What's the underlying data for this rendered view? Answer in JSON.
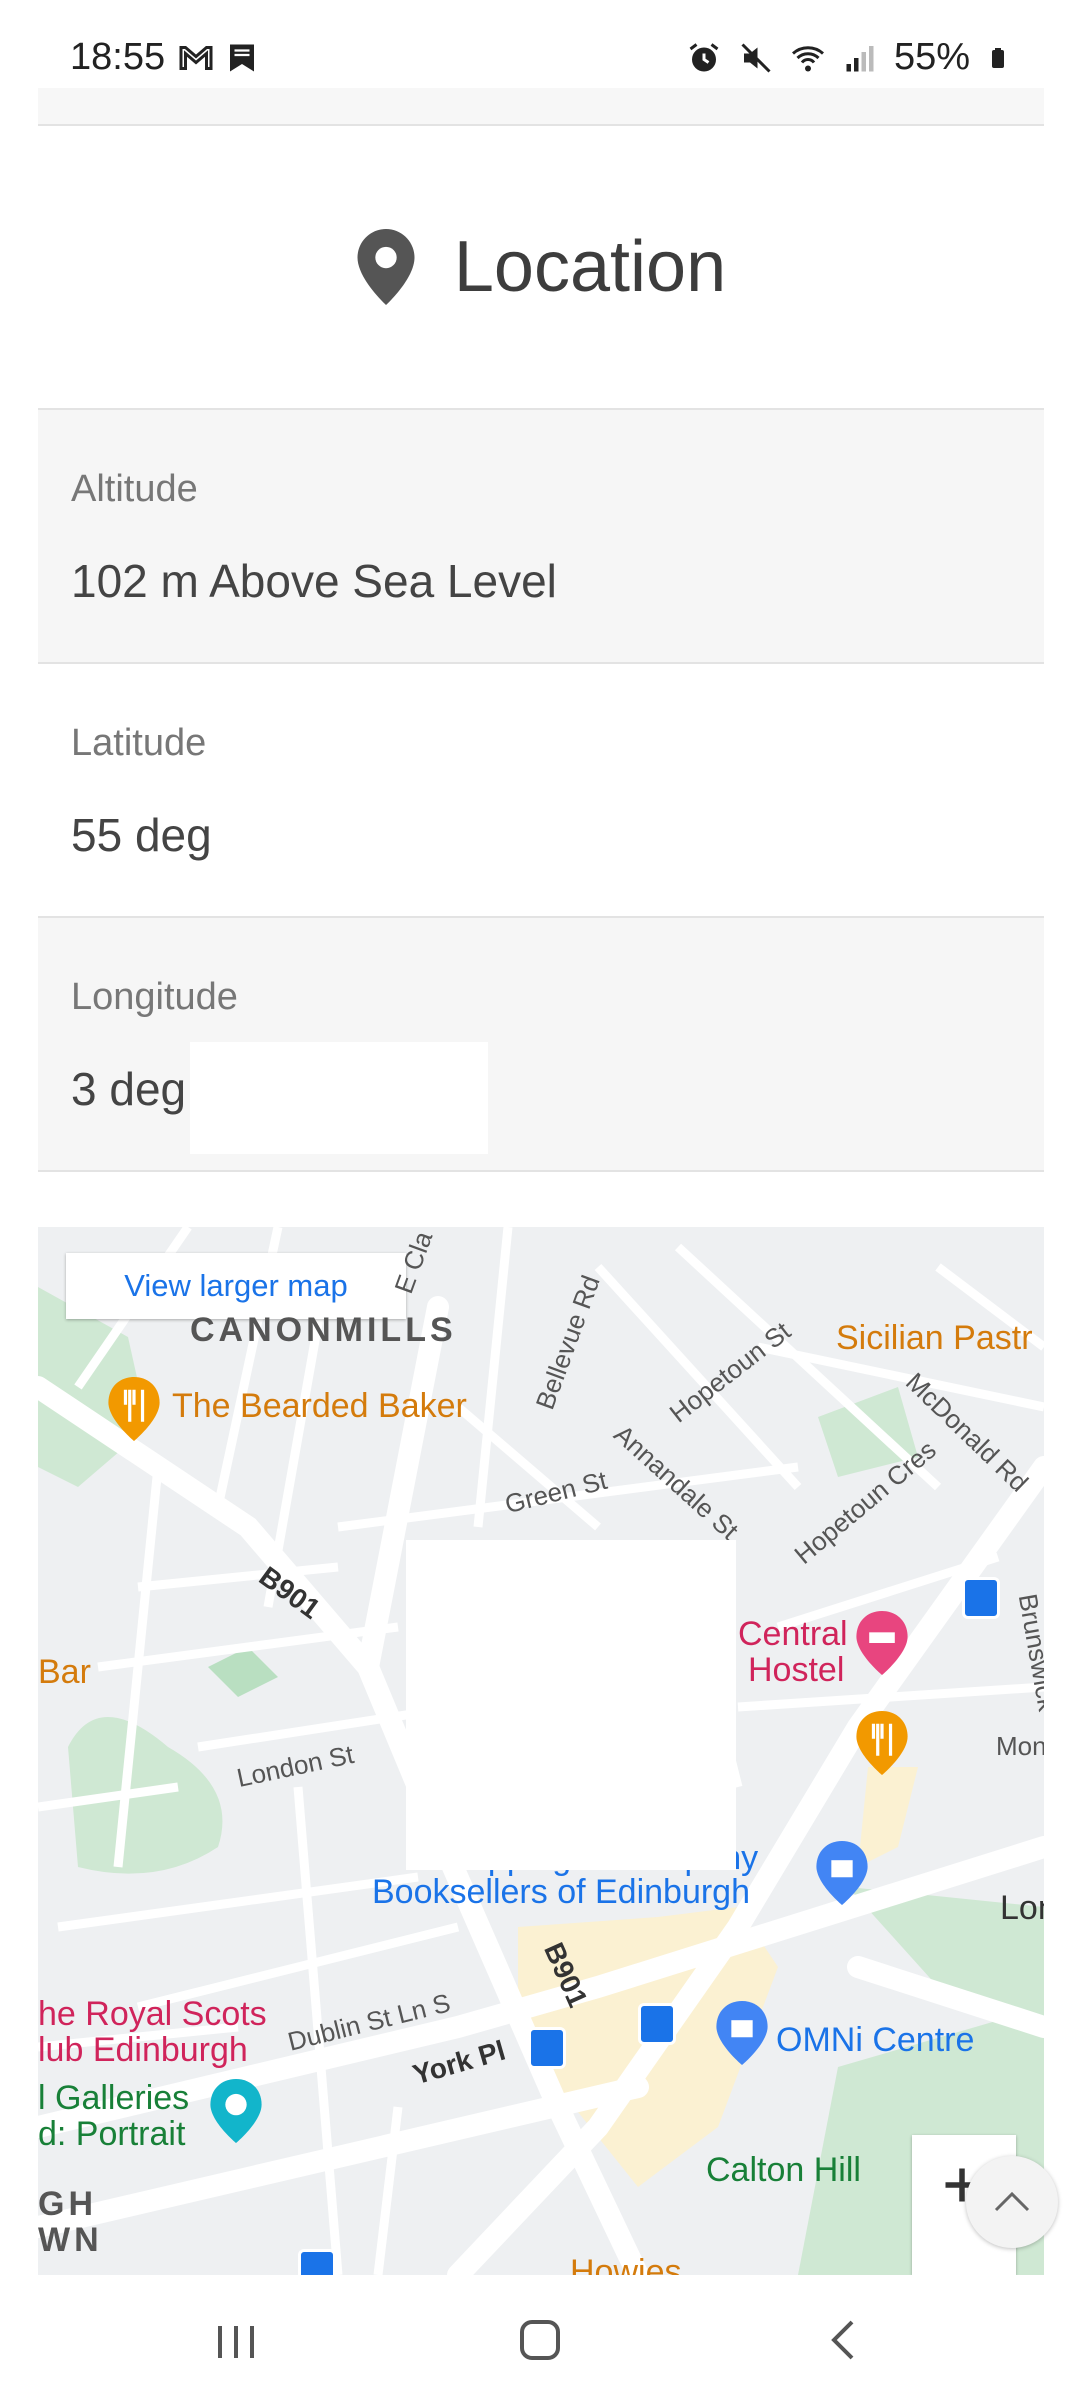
{
  "status_bar": {
    "time": "18:55",
    "battery": "55%"
  },
  "location": {
    "title": "Location",
    "rows": [
      {
        "label": "Altitude",
        "value": "102 m Above Sea Level"
      },
      {
        "label": "Latitude",
        "value": "55 deg"
      },
      {
        "label": "Longitude",
        "value": "3 deg"
      }
    ]
  },
  "map": {
    "view_larger_label": "View larger map",
    "labels": {
      "canonmills": "CANONMILLS",
      "bearded_baker": "The Bearded Baker",
      "sicilian": "Sicilian Pastr",
      "central_hostel_1": "Central",
      "central_hostel_2": "Hostel",
      "bar": "Bar",
      "topping_1": "Topping & Company",
      "topping_2": "Booksellers of Edinburgh",
      "royal_scots_1": "he Royal Scots",
      "royal_scots_2": "lub Edinburgh",
      "galleries_1": "l Galleries",
      "galleries_2": "d: Portrait",
      "omni": "OMNi Centre",
      "calton": "Calton Hill",
      "howies": "Howies",
      "gh": "GH",
      "wn": "WN",
      "lon": "Lon",
      "mon": "Mon",
      "green_st": "Green St",
      "bellevue": "Bellevue Rd",
      "hopetoun_st": "Hopetoun St",
      "annandale": "Annandale St",
      "mcdonald": "McDonald Rd",
      "hopetoun_cres": "Hopetoun Cres",
      "brunswick": "Brunswick",
      "london_st": "London St",
      "dublin": "Dublin St Ln S",
      "york": "York Pl",
      "b901_1": "B901",
      "b901_2": "B901",
      "e_cla": "E Cla"
    }
  },
  "colors": {
    "map_blue": "#1a73e8",
    "food_orange": "#d47b0c",
    "hotel_pink": "#d0245b",
    "park_green": "#188038"
  }
}
